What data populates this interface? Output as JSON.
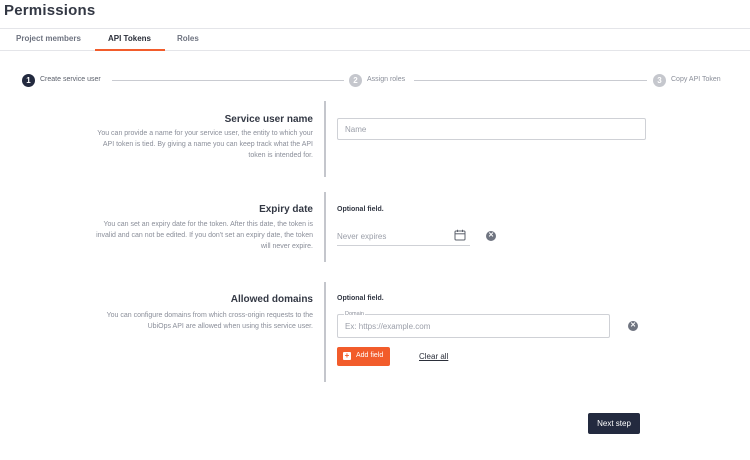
{
  "page": {
    "title": "Permissions"
  },
  "tabs": [
    {
      "label": "Project members"
    },
    {
      "label": "API Tokens"
    },
    {
      "label": "Roles"
    }
  ],
  "stepper": {
    "steps": [
      {
        "number": "1",
        "label": "Create service user"
      },
      {
        "number": "2",
        "label": "Assign roles"
      },
      {
        "number": "3",
        "label": "Copy API Token"
      }
    ]
  },
  "service_user": {
    "title": "Service user name",
    "description": "You can provide a name for your service user, the entity to which your API token is tied. By giving a name you can keep track what the API token is intended for.",
    "name_placeholder": "Name"
  },
  "expiry": {
    "title": "Expiry date",
    "description": "You can set an expiry date for the token. After this date, the token is invalid and can not be edited. If you don't set an expiry date, the token will never expire.",
    "optional_label": "Optional field.",
    "placeholder": "Never expires"
  },
  "domains": {
    "title": "Allowed domains",
    "description": "You can configure domains from which cross-origin requests to the UbiOps API are allowed when using this service user.",
    "optional_label": "Optional field.",
    "field_label": "Domain",
    "placeholder": "Ex: https://example.com",
    "add_label": "Add field",
    "clear_all_label": "Clear all"
  },
  "footer": {
    "next_label": "Next step"
  },
  "colors": {
    "accent": "#f25c2b",
    "primary_dark": "#232a3f"
  },
  "icons": {
    "calendar": "calendar-icon",
    "clear": "clear-icon",
    "add": "plus-icon"
  }
}
